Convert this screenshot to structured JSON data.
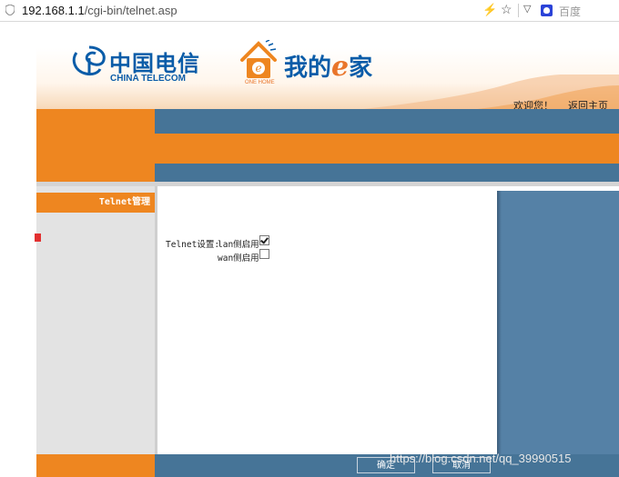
{
  "browser": {
    "url_host": "192.168.1.1",
    "url_path": "/cgi-bin/telnet.asp",
    "search_placeholder": "百度"
  },
  "header": {
    "brand_cn": "中国电信",
    "brand_en": "CHINA TELECOM",
    "product_pre": "我的",
    "product_e": "e",
    "product_post": "家",
    "product_sub": "ONE HOME",
    "welcome": "欢迎您！",
    "home_link": "返回主页"
  },
  "sidebar": {
    "items": [
      {
        "label": "Telnet管理",
        "active": true
      }
    ]
  },
  "form": {
    "section_label": "Telnet设置:",
    "options": [
      {
        "label": "lan侧启用",
        "checked": true
      },
      {
        "label": "wan侧启用",
        "checked": false
      }
    ]
  },
  "footer": {
    "ok_label": "确定",
    "cancel_label": "取消",
    "watermark": "https://blog.csdn.net/qq_39990515"
  },
  "colors": {
    "orange": "#ee8620",
    "steel_blue": "#467497",
    "brand_blue": "#0a5ca8"
  }
}
